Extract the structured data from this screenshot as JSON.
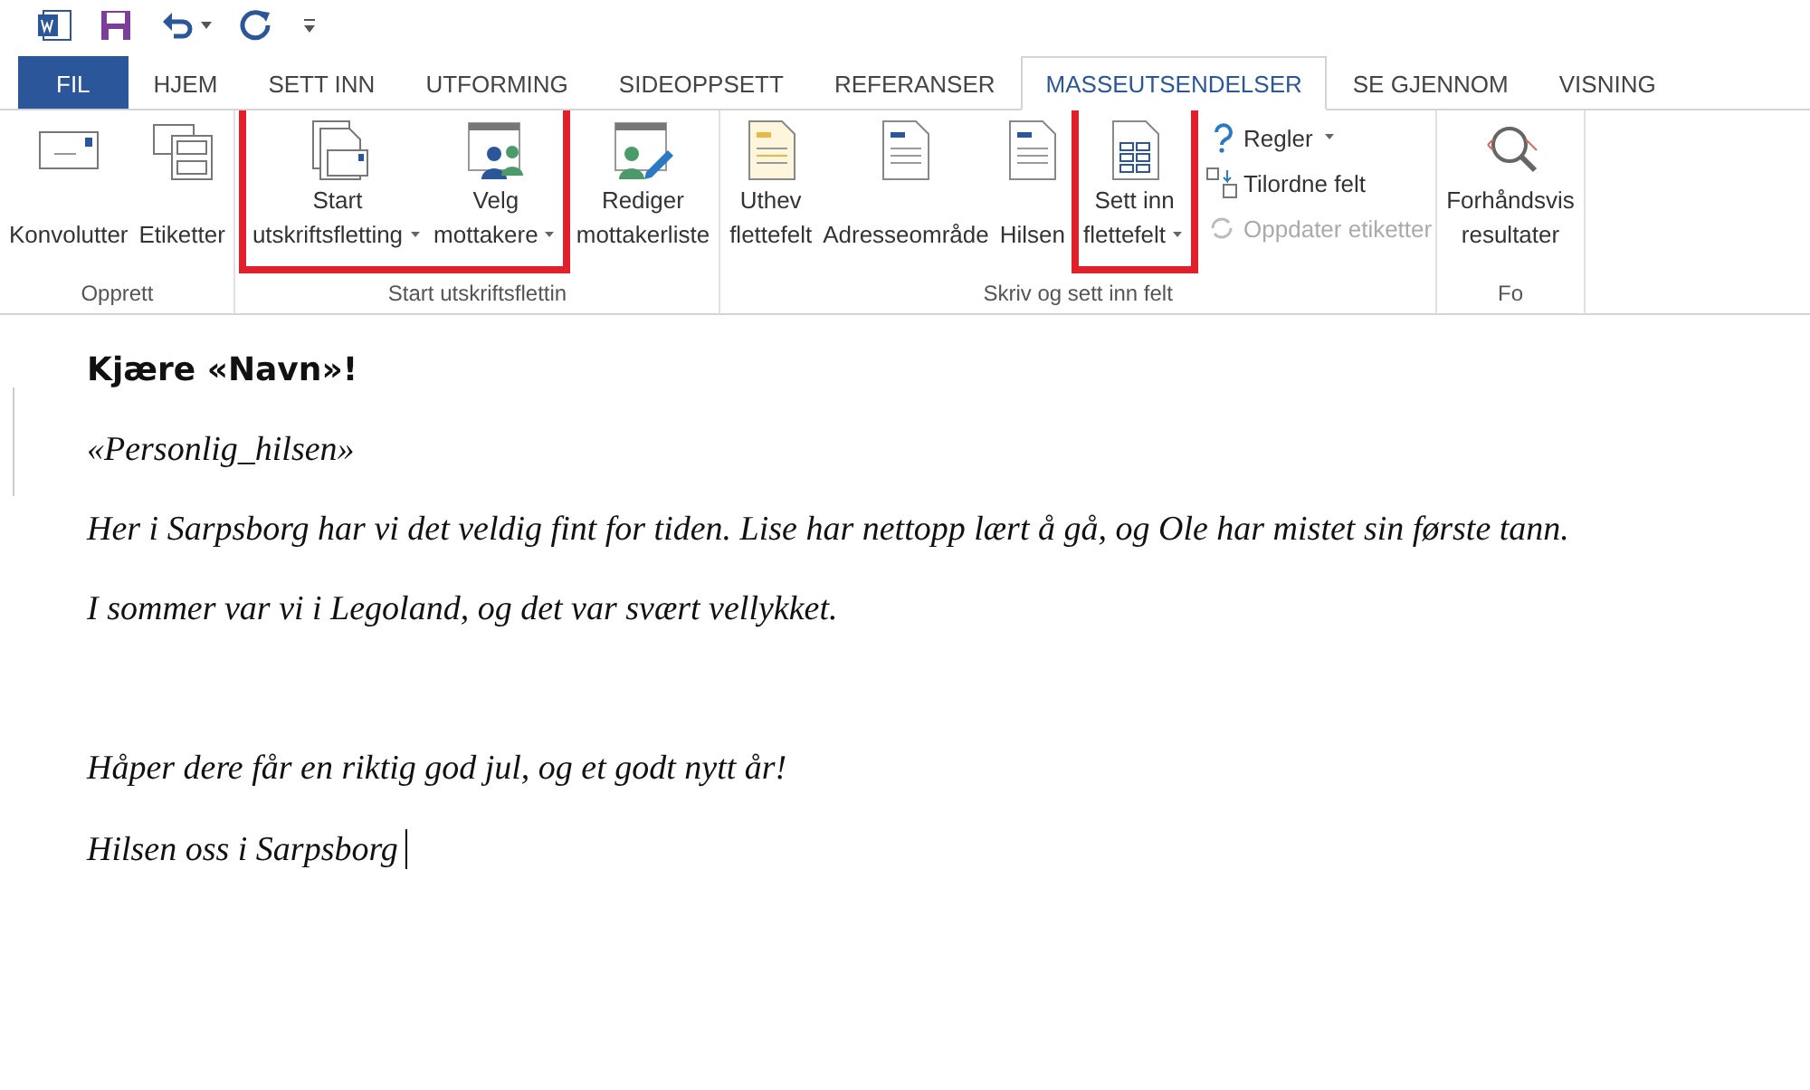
{
  "quick_access": [
    {
      "kind": "word"
    },
    {
      "kind": "save"
    },
    {
      "kind": "undo",
      "dropdown": true
    },
    {
      "kind": "redo"
    },
    {
      "kind": "customize"
    }
  ],
  "tabs": [
    {
      "label": "FIL",
      "kind": "file",
      "selected": false
    },
    {
      "label": "HJEM",
      "kind": "tab",
      "selected": false
    },
    {
      "label": "SETT INN",
      "kind": "tab",
      "selected": false
    },
    {
      "label": "UTFORMING",
      "kind": "tab",
      "selected": false
    },
    {
      "label": "SIDEOPPSETT",
      "kind": "tab",
      "selected": false
    },
    {
      "label": "REFERANSER",
      "kind": "tab",
      "selected": false
    },
    {
      "label": "MASSEUTSENDELSER",
      "kind": "tab",
      "selected": true
    },
    {
      "label": "SE GJENNOM",
      "kind": "tab",
      "selected": false
    },
    {
      "label": "VISNING",
      "kind": "tab",
      "selected": false
    }
  ],
  "ribbon_groups": [
    {
      "label": "Opprett",
      "buttons": [
        {
          "kind": "large",
          "lines": [
            "Konvolutter"
          ],
          "dropdown": false,
          "highlighted": false,
          "disabled": false
        },
        {
          "kind": "large",
          "lines": [
            "Etiketter"
          ],
          "dropdown": false,
          "highlighted": false,
          "disabled": false
        }
      ]
    },
    {
      "label": "Start utskriftsflettin",
      "buttons": [
        {
          "kind": "large",
          "lines": [
            "Start",
            "utskriftsfletting"
          ],
          "dropdown": true,
          "highlighted": true,
          "disabled": false
        },
        {
          "kind": "large",
          "lines": [
            "Velg",
            "mottakere"
          ],
          "dropdown": true,
          "highlighted": true,
          "disabled": false
        },
        {
          "kind": "large",
          "lines": [
            "Rediger",
            "mottakerliste"
          ],
          "dropdown": false,
          "highlighted": false,
          "disabled": false
        }
      ]
    },
    {
      "label": "Skriv og sett inn felt",
      "buttons": [
        {
          "kind": "large",
          "lines": [
            "Uthev",
            "flettefelt"
          ],
          "dropdown": false,
          "highlighted": false,
          "disabled": false
        },
        {
          "kind": "large",
          "lines": [
            "Adresseområde"
          ],
          "dropdown": false,
          "highlighted": false,
          "disabled": false
        },
        {
          "kind": "large",
          "lines": [
            "Hilsen"
          ],
          "dropdown": false,
          "highlighted": false,
          "disabled": false
        },
        {
          "kind": "large",
          "lines": [
            "Sett inn",
            "flettefelt"
          ],
          "dropdown": true,
          "highlighted": true,
          "disabled": false
        },
        {
          "kind": "small",
          "lines": [
            "Regler"
          ],
          "dropdown": true,
          "highlighted": false,
          "disabled": false
        },
        {
          "kind": "small",
          "lines": [
            "Tilordne felt"
          ],
          "dropdown": false,
          "highlighted": false,
          "disabled": false
        },
        {
          "kind": "small",
          "lines": [
            "Oppdater etiketter"
          ],
          "dropdown": false,
          "highlighted": false,
          "disabled": true
        }
      ]
    },
    {
      "label": "Fo",
      "buttons": [
        {
          "kind": "large",
          "lines": [
            "Forhåndsvis",
            "resultater"
          ],
          "dropdown": false,
          "highlighted": false,
          "disabled": false
        }
      ]
    }
  ],
  "document": [
    {
      "kind": "heading",
      "text": "Kjære «Navn»!"
    },
    {
      "kind": "text",
      "text": "«Personlig_hilsen»"
    },
    {
      "kind": "text",
      "text": "Her i Sarpsborg har vi det veldig fint for tiden. Lise har nettopp lært å gå, og Ole har mistet sin første tann."
    },
    {
      "kind": "text",
      "text": "I sommer var vi i Legoland, og det var svært vellykket."
    },
    {
      "kind": "blank"
    },
    {
      "kind": "text",
      "text": "Håper dere får en riktig god jul, og et godt nytt år!"
    },
    {
      "kind": "caret",
      "text": "Hilsen oss i Sarpsborg"
    }
  ]
}
